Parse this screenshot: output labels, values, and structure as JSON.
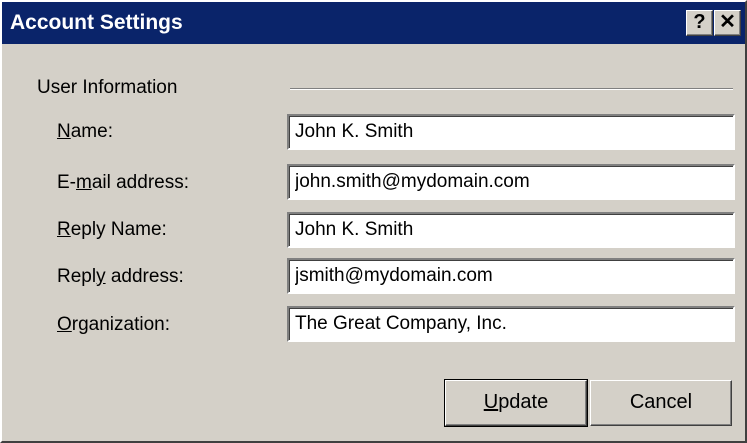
{
  "window": {
    "title": "Account Settings",
    "help_label": "?",
    "close_label": "✕"
  },
  "group": {
    "label": "User Information"
  },
  "fields": [
    {
      "label_pre": "",
      "label_key": "N",
      "label_post": "ame:",
      "value": "John K. Smith"
    },
    {
      "label_pre": "E-",
      "label_key": "m",
      "label_post": "ail address:",
      "value": "john.smith@mydomain.com"
    },
    {
      "label_pre": "",
      "label_key": "R",
      "label_post": "eply Name:",
      "value": "John K. Smith"
    },
    {
      "label_pre": "Repl",
      "label_key": "y",
      "label_post": " address:",
      "value": "jsmith@mydomain.com"
    },
    {
      "label_pre": "",
      "label_key": "O",
      "label_post": "rganization:",
      "value": "The Great Company, Inc."
    }
  ],
  "buttons": {
    "update_key": "U",
    "update_rest": "pdate",
    "cancel": "Cancel"
  },
  "colors": {
    "titlebar": "#0a246a",
    "face": "#d4d0c8"
  }
}
